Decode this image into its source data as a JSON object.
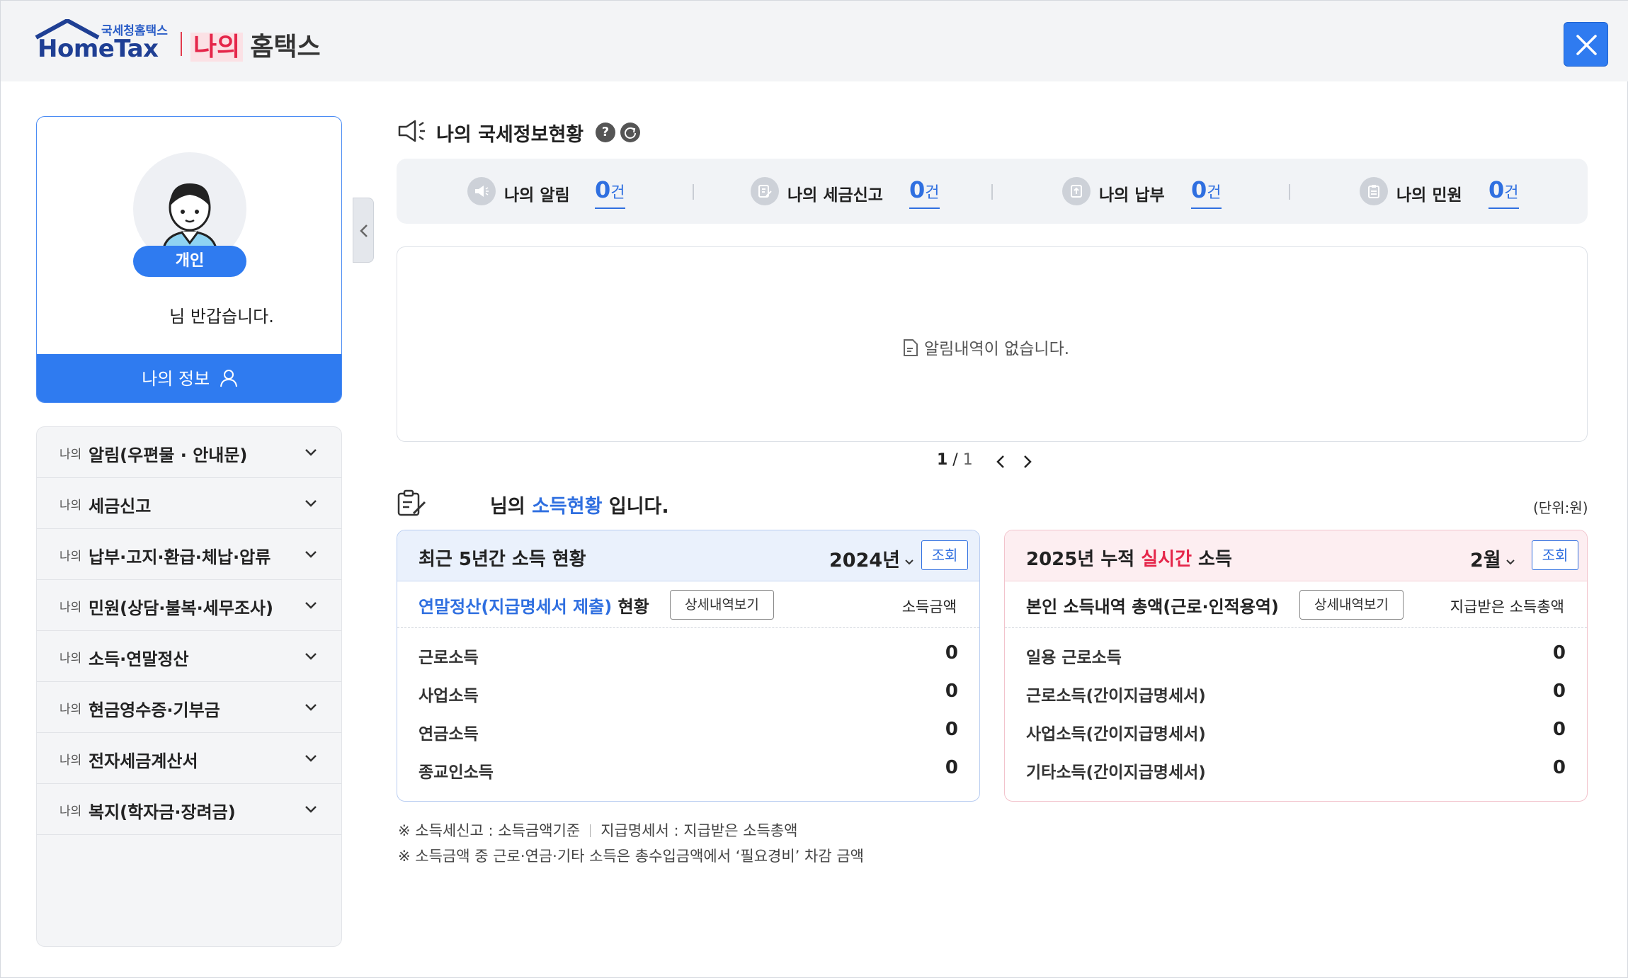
{
  "header": {
    "logo_small": "국세청홈택스",
    "logo_text": "HomeTax",
    "title_highlight": "나의",
    "title_rest": "홈택스"
  },
  "profile": {
    "badge": "개인",
    "greeting": "님 반갑습니다.",
    "myinfo_label": "나의 정보"
  },
  "menu": {
    "prefix": "나의",
    "items": [
      {
        "label": "알림(우편물 · 안내문)"
      },
      {
        "label": "세금신고"
      },
      {
        "label": "납부·고지·환급·체납·압류"
      },
      {
        "label": "민원(상담·불복·세무조사)"
      },
      {
        "label": "소득·연말정산"
      },
      {
        "label": "현금영수증·기부금"
      },
      {
        "label": "전자세금계산서"
      },
      {
        "label": "복지(학자금·장려금)"
      }
    ]
  },
  "status": {
    "title": "나의 국세정보현황",
    "help": "?",
    "stats": [
      {
        "label": "나의 알림",
        "count": "0",
        "unit": "건",
        "icon": "megaphone-icon"
      },
      {
        "label": "나의 세금신고",
        "count": "0",
        "unit": "건",
        "icon": "form-edit-icon"
      },
      {
        "label": "나의 납부",
        "count": "0",
        "unit": "건",
        "icon": "payment-icon"
      },
      {
        "label": "나의 민원",
        "count": "0",
        "unit": "건",
        "icon": "clipboard-icon"
      }
    ]
  },
  "notice": {
    "empty_text": "알림내역이 없습니다."
  },
  "pager": {
    "current": "1",
    "separator": " / ",
    "total": "1"
  },
  "income": {
    "title_pre": "님의 ",
    "title_blue": "소득현황",
    "title_post": " 입니다.",
    "unit_note": "(단위:원)"
  },
  "panel_left": {
    "title": "최근 5년간 소득 현황",
    "year": "2024년",
    "query": "조회",
    "sub_blue": "연말정산(지급명세서 제출)",
    "sub_rest": " 현황",
    "detail": "상세내역보기",
    "col": "소득금액",
    "rows": [
      {
        "label": "근로소득",
        "value": "0"
      },
      {
        "label": "사업소득",
        "value": "0"
      },
      {
        "label": "연금소득",
        "value": "0"
      },
      {
        "label": "종교인소득",
        "value": "0"
      }
    ]
  },
  "panel_right": {
    "title_pre": "2025년 누적 ",
    "title_red": "실시간",
    "title_post": " 소득",
    "month": "2월",
    "query": "조회",
    "sub": "본인 소득내역 총액(근로·인적용역)",
    "detail": "상세내역보기",
    "col": "지급받은 소득총액",
    "rows": [
      {
        "label": "일용 근로소득",
        "value": "0"
      },
      {
        "label": "근로소득(간이지급명세서)",
        "value": "0"
      },
      {
        "label": "사업소득(간이지급명세서)",
        "value": "0"
      },
      {
        "label": "기타소득(간이지급명세서)",
        "value": "0"
      }
    ]
  },
  "footnotes": {
    "line1a": "※ 소득세신고 : 소득금액기준",
    "line1b": "지급명세서 : 지급받은 소득총액",
    "line2": "※ 소득금액 중 근로·연금·기타 소득은 총수입금액에서 ‘필요경비’ 차감 금액"
  },
  "colors": {
    "primary": "#2f7bf0",
    "accent_red": "#e5264a",
    "brand_navy": "#1f3f94"
  }
}
